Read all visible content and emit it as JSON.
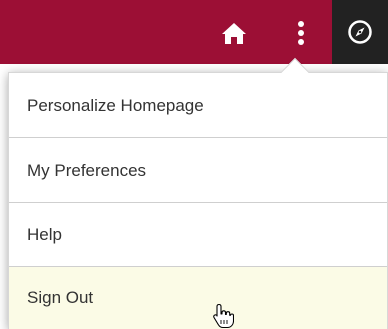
{
  "header": {
    "colors": {
      "bar": "#9c0f35",
      "strip": "#222222",
      "icon": "#ffffff"
    },
    "home_icon": "home-icon",
    "actions_icon": "vertical-ellipsis-icon",
    "navbar_icon": "compass-icon"
  },
  "menu": {
    "items": [
      {
        "label": "Personalize Homepage"
      },
      {
        "label": "My Preferences"
      },
      {
        "label": "Help"
      },
      {
        "label": "Sign Out",
        "hovered": true
      }
    ],
    "hover_color": "#fbfbe6"
  },
  "pointer": {
    "icon": "hand-pointer-icon"
  }
}
